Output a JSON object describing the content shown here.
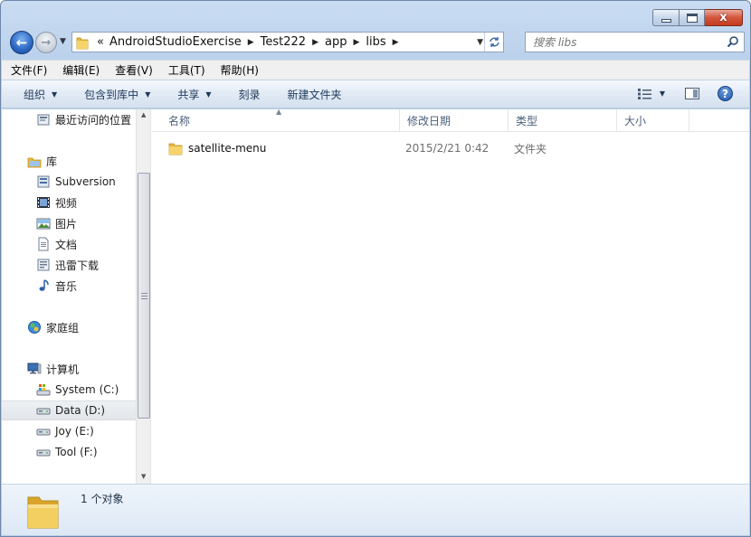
{
  "window": {
    "caption_close": "x"
  },
  "nav": {
    "back_glyph": "←",
    "forward_glyph": "→",
    "breadcrumb_lead": "«",
    "breadcrumbs": [
      "AndroidStudioExercise",
      "Test222",
      "app",
      "libs"
    ],
    "search_placeholder": "搜索 libs"
  },
  "menubar": {
    "items": [
      "文件(F)",
      "编辑(E)",
      "查看(V)",
      "工具(T)",
      "帮助(H)"
    ]
  },
  "toolbar": {
    "organize": "组织",
    "include_in_library": "包含到库中",
    "share": "共享",
    "burn": "刻录",
    "new_folder": "新建文件夹",
    "help": "?"
  },
  "sidebar": {
    "recent": "最近访问的位置",
    "library": "库",
    "library_items": [
      "Subversion",
      "视频",
      "图片",
      "文档",
      "迅雷下载",
      "音乐"
    ],
    "homegroup": "家庭组",
    "computer": "计算机",
    "drives": [
      "System (C:)",
      "Data (D:)",
      "Joy (E:)",
      "Tool (F:)"
    ],
    "selected": "Data (D:)"
  },
  "columns": {
    "name": "名称",
    "date": "修改日期",
    "type": "类型",
    "size": "大小"
  },
  "files": [
    {
      "name": "satellite-menu",
      "date": "2015/2/21 0:42",
      "type": "文件夹",
      "size": ""
    }
  ],
  "details": {
    "count": "1 个对象"
  },
  "colors": {
    "folder": "#e8b93a",
    "accent": "#1e55a8"
  }
}
